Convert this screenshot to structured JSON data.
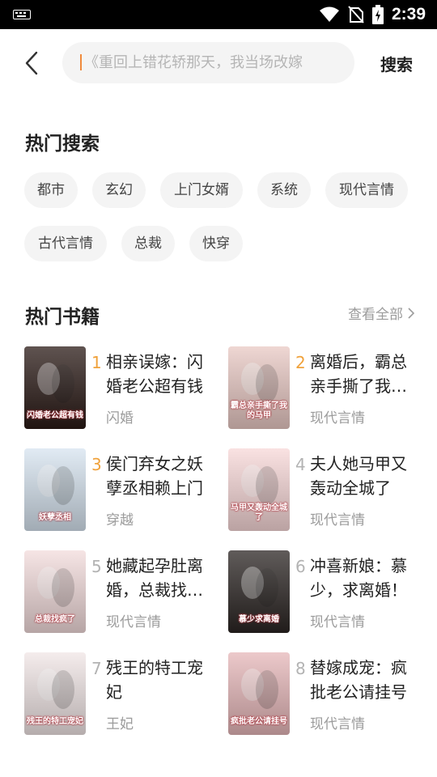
{
  "status_bar": {
    "time": "2:39"
  },
  "search": {
    "placeholder": "《重回上错花轿那天，我当场改嫁",
    "button_label": "搜索"
  },
  "hot_search": {
    "title": "热门搜索",
    "tags": [
      "都市",
      "玄幻",
      "上门女婿",
      "系统",
      "现代言情",
      "古代言情",
      "总裁",
      "快穿"
    ]
  },
  "hot_books": {
    "title": "热门书籍",
    "view_all": "查看全部",
    "books": [
      {
        "rank": "1",
        "title": "相亲误嫁：闪婚老公超有钱",
        "category": "闪婚",
        "cover_text": "闪婚老公超有钱",
        "cover_color": "#2a1a16"
      },
      {
        "rank": "2",
        "title": "离婚后，霸总亲手撕了我…",
        "category": "现代言情",
        "cover_text": "霸总亲手撕了我的马甲",
        "cover_color": "#e9c9c4"
      },
      {
        "rank": "3",
        "title": "侯门弃女之妖孽丞相赖上门",
        "category": "穿越",
        "cover_text": "妖孽丞相",
        "cover_color": "#d7e4f0"
      },
      {
        "rank": "4",
        "title": "夫人她马甲又轰动全城了",
        "category": "现代言情",
        "cover_text": "马甲又轰动全城了",
        "cover_color": "#f8d8d8"
      },
      {
        "rank": "5",
        "title": "她藏起孕肚离婚，总裁找…",
        "category": "现代言情",
        "cover_text": "总裁找疯了",
        "cover_color": "#f3dcdc"
      },
      {
        "rank": "6",
        "title": "冲喜新娘：慕少，求离婚！",
        "category": "现代言情",
        "cover_text": "慕少求离婚",
        "cover_color": "#2b2523"
      },
      {
        "rank": "7",
        "title": "残王的特工宠妃",
        "category": "王妃",
        "cover_text": "残王的特工宠妃",
        "cover_color": "#f1e6e6"
      },
      {
        "rank": "8",
        "title": "替嫁成宠：疯批老公请挂号",
        "category": "现代言情",
        "cover_text": "疯批老公请挂号",
        "cover_color": "#e6b7b9"
      }
    ]
  },
  "colors": {
    "accent": "#f08a3c",
    "rank_top": "#f0a23c",
    "rank_other": "#b3b3b3",
    "tag_bg": "#f4f4f4"
  }
}
